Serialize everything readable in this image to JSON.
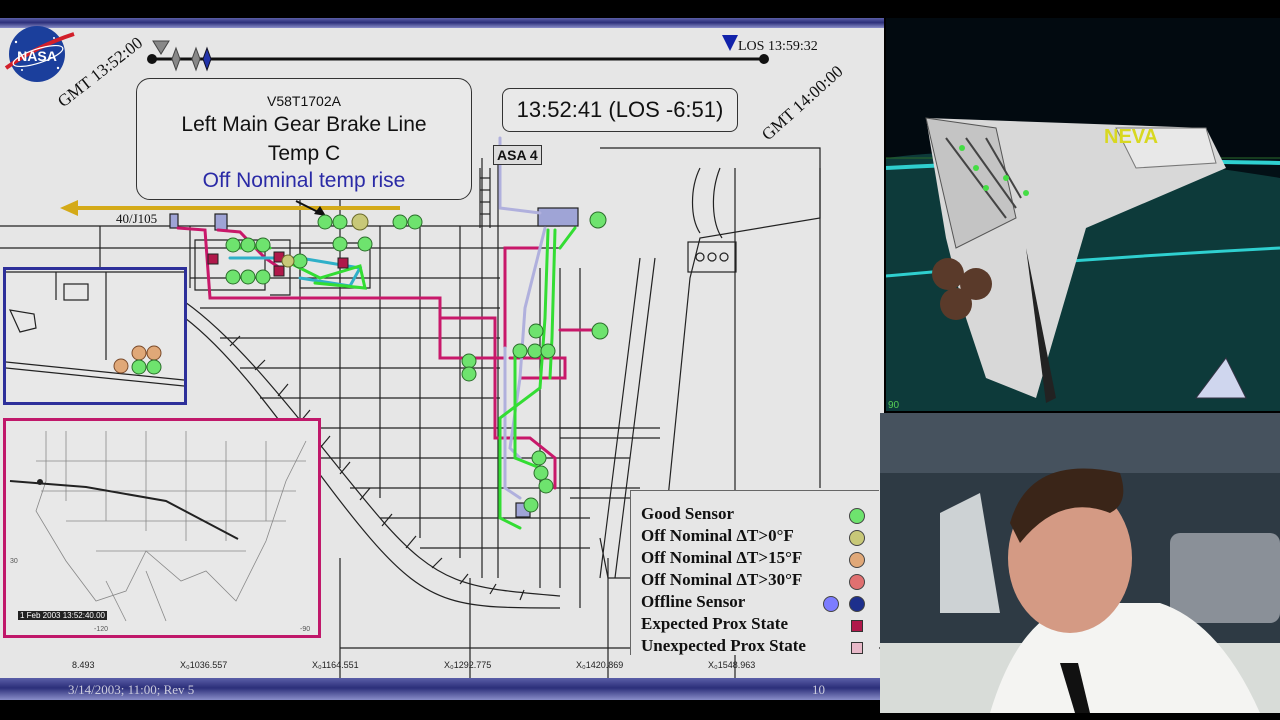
{
  "slide": {
    "logo_text": "NASA",
    "gmt_start": "GMT 13:52:00",
    "gmt_end": "GMT 14:00:00",
    "los_label": "LOS 13:59:32",
    "callout": {
      "sensor_id": "V58T1702A",
      "title_line1": "Left Main Gear Brake Line",
      "title_line2": "Temp C",
      "status": "Off Nominal temp rise"
    },
    "clock": "13:52:41 (LOS -6:51)",
    "asa_label": "ASA 4",
    "connector_label": "40/J105",
    "map_timestamp": "1 Feb 2003 13:52:40.00",
    "map_tick_left": "-120",
    "map_tick_right": "-90",
    "map_tick_lat": "30",
    "coords": [
      "8.493",
      "X₀1036.557",
      "X₀1164.551",
      "X₀1292.775",
      "X₀1420.869",
      "X₀1548.963"
    ],
    "footer_date": "3/14/2003; 11:00; Rev 5",
    "footer_page": "10"
  },
  "legend": [
    {
      "label": "Good Sensor",
      "marker": "circle",
      "colors": [
        "#6ee36e"
      ]
    },
    {
      "label": "Off Nominal ΔT>0°F",
      "marker": "circle",
      "colors": [
        "#c8c878"
      ]
    },
    {
      "label": "Off Nominal ΔT>15°F",
      "marker": "circle",
      "colors": [
        "#e0a878"
      ]
    },
    {
      "label": "Off Nominal ΔT>30°F",
      "marker": "circle",
      "colors": [
        "#e07070"
      ]
    },
    {
      "label": "Offline Sensor",
      "marker": "circle",
      "colors": [
        "#7c7cff",
        "#1d2f8c"
      ]
    },
    {
      "label": "Expected Prox State",
      "marker": "square",
      "colors": [
        "#b0184a"
      ]
    },
    {
      "label": "Unexpected Prox State",
      "marker": "square",
      "colors": [
        "#e8b8c8"
      ]
    }
  ],
  "video": {
    "overlay_text": "NEVA",
    "corner_text": "90"
  },
  "colors": {
    "good": "#6ee36e",
    "pink_wire": "#c8186a",
    "green_wire": "#33dd33",
    "blue_wire": "#a8a8d8",
    "gold_arrow": "#d4aa18"
  }
}
